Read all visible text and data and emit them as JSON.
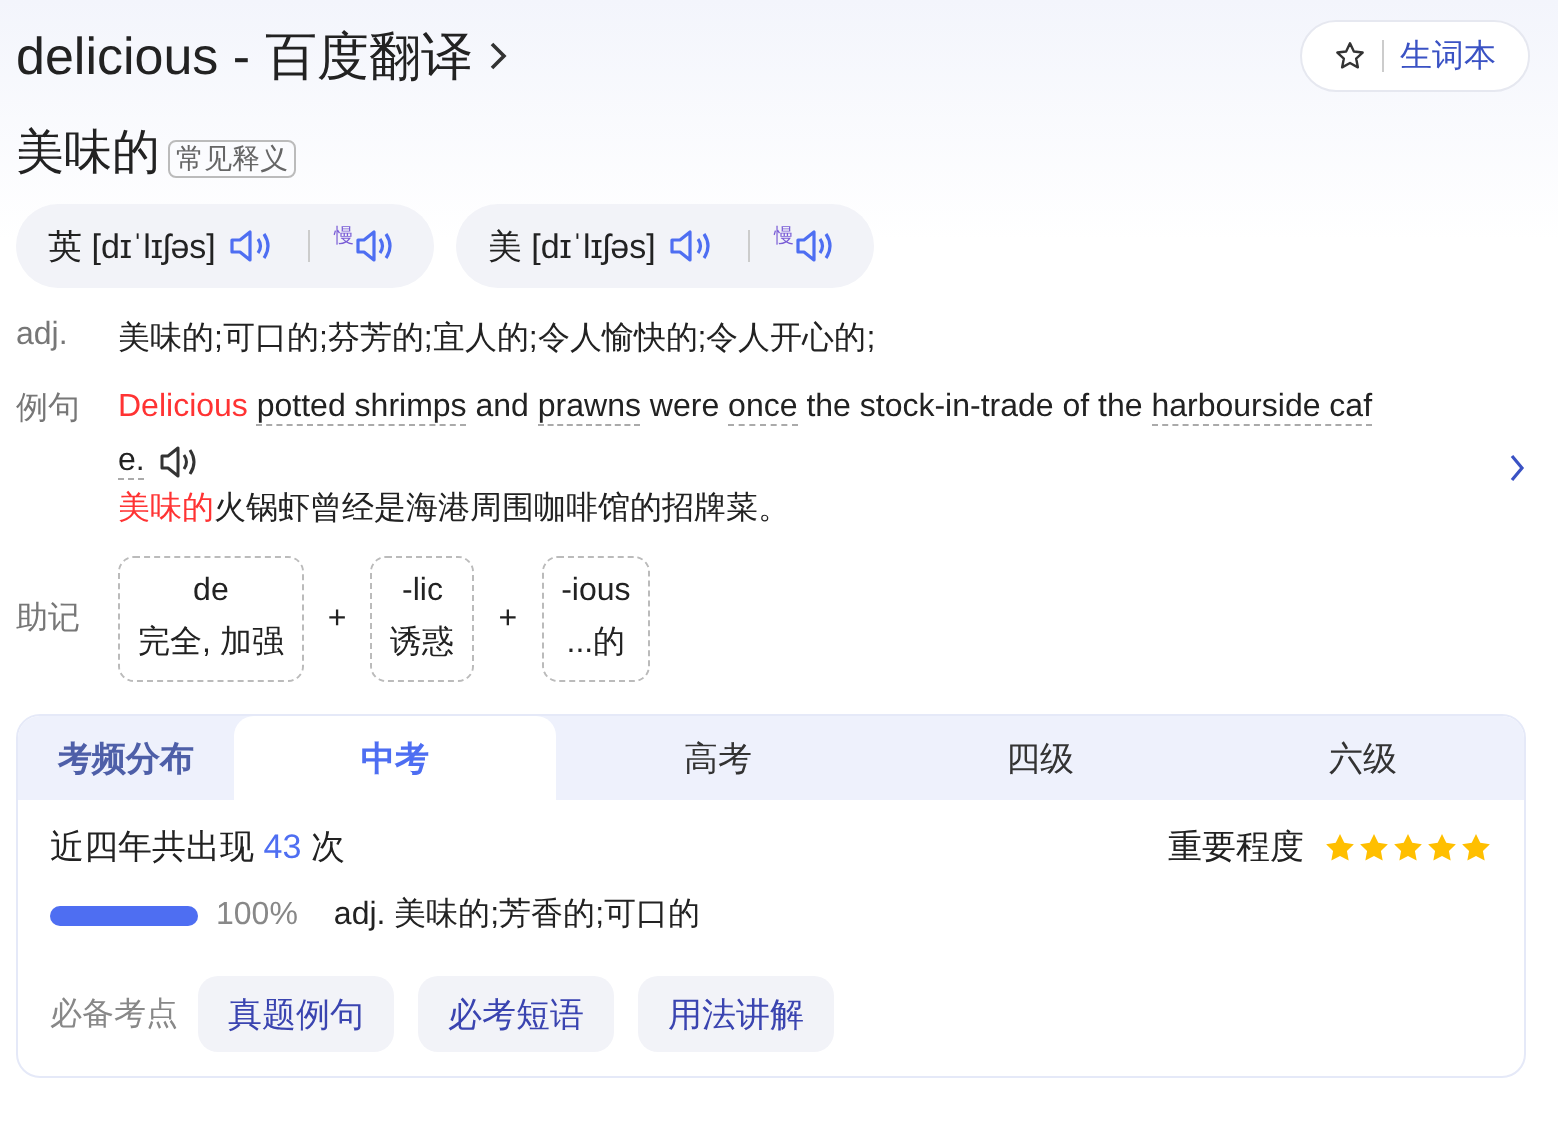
{
  "header": {
    "title": "delicious - 百度翻译",
    "vocab_button": "生词本"
  },
  "headword": {
    "meaning": "美味的",
    "tag": "常见释义"
  },
  "pronunciations": [
    {
      "region": "英",
      "phonetic": "[dɪˈlɪʃəs]",
      "slow_label": "慢"
    },
    {
      "region": "美",
      "phonetic": "[dɪˈlɪʃəs]",
      "slow_label": "慢"
    }
  ],
  "definition": {
    "pos": "adj.",
    "text": "美味的;可口的;芬芳的;宜人的;令人愉快的;令人开心的;"
  },
  "example": {
    "label": "例句",
    "sentence": [
      {
        "kind": "highlight",
        "text": "Delicious "
      },
      {
        "kind": "underlined",
        "text": "potted shrimps"
      },
      {
        "kind": "plain",
        "text": " and "
      },
      {
        "kind": "underlined",
        "text": "prawns"
      },
      {
        "kind": "plain",
        "text": " were "
      },
      {
        "kind": "underlined",
        "text": "once"
      },
      {
        "kind": "plain",
        "text": " the stock-in-trade of the "
      },
      {
        "kind": "underlined",
        "text": "harbourside cafe."
      }
    ],
    "translation": [
      {
        "kind": "highlight",
        "text": "美味的"
      },
      {
        "kind": "plain",
        "text": "火锅虾曾经是海港周围咖啡馆的招牌菜。"
      }
    ]
  },
  "mnemonic": {
    "label": "助记",
    "parts": [
      {
        "root": "de",
        "meaning": "完全, 加强"
      },
      {
        "root": "-lic",
        "meaning": "诱惑"
      },
      {
        "root": "-ious",
        "meaning": "...的"
      }
    ],
    "joiner": "+"
  },
  "exam": {
    "title": "考频分布",
    "tabs": [
      {
        "label": "中考",
        "selected": true
      },
      {
        "label": "高考",
        "selected": false
      },
      {
        "label": "四级",
        "selected": false
      },
      {
        "label": "六级",
        "selected": false
      }
    ],
    "count_prefix": "近四年共出现",
    "count": "43",
    "count_suffix": "次",
    "importance_label": "重要程度",
    "stars": 5,
    "level": 1.0,
    "percent": "100%",
    "meaning": "adj. 美味的;芳香的;可口的",
    "points_label": "必备考点",
    "points": [
      "真题例句",
      "必考短语",
      "用法讲解"
    ]
  }
}
